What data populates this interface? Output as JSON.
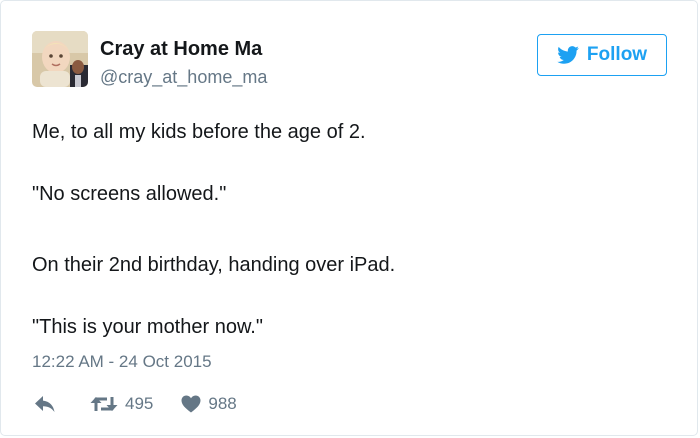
{
  "user": {
    "display_name": "Cray at Home Ma",
    "handle": "@cray_at_home_ma"
  },
  "follow_button": {
    "label": "Follow",
    "icon": "twitter-bird-icon"
  },
  "tweet": {
    "lines": [
      "Me, to all my kids before the age of 2.",
      "\"No screens allowed.\"",
      "On their 2nd birthday, handing over iPad.",
      "\"This is your mother now.\""
    ],
    "timestamp": "12:22 AM - 24 Oct 2015"
  },
  "actions": {
    "reply_icon": "reply-icon",
    "retweet_icon": "retweet-icon",
    "retweet_count": "495",
    "like_icon": "heart-icon",
    "like_count": "988"
  },
  "colors": {
    "accent": "#1da1f2",
    "text": "#14171a",
    "muted": "#657786",
    "border": "#e1e8ed"
  }
}
